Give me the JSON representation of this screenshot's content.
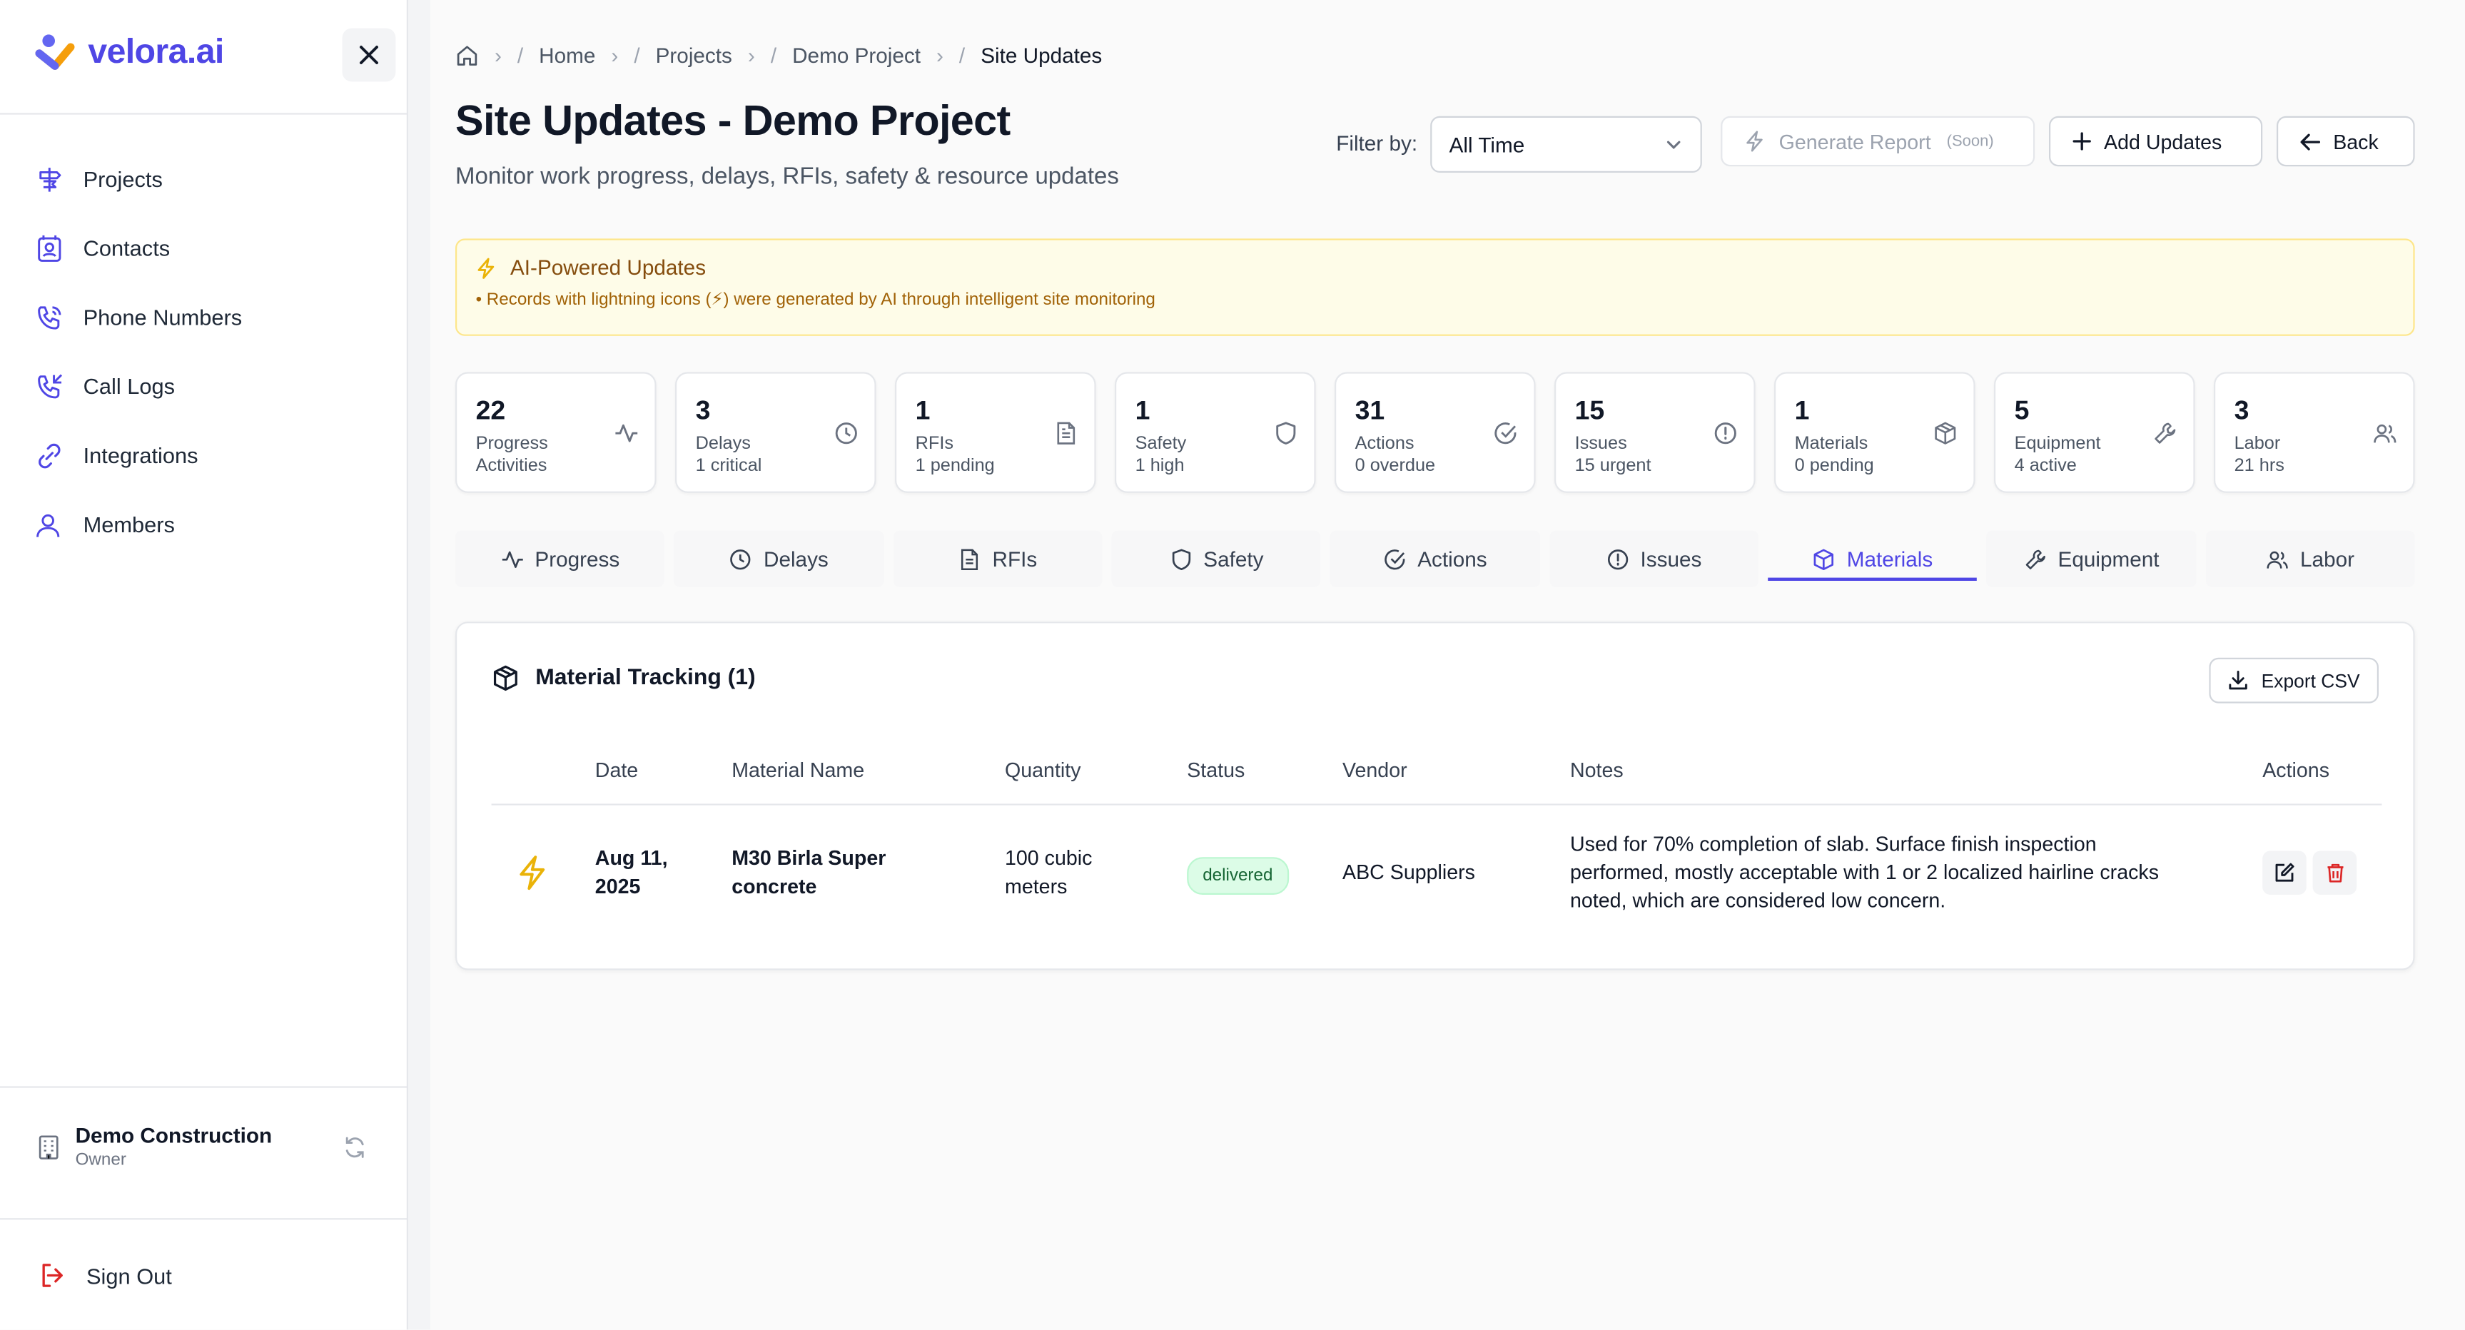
{
  "sidebar": {
    "brand": "velora.ai",
    "items": [
      {
        "label": "Projects",
        "icon": "signpost-icon"
      },
      {
        "label": "Contacts",
        "icon": "contact-icon"
      },
      {
        "label": "Phone Numbers",
        "icon": "phone-icon"
      },
      {
        "label": "Call Logs",
        "icon": "phone-log-icon"
      },
      {
        "label": "Integrations",
        "icon": "link-icon"
      },
      {
        "label": "Members",
        "icon": "users-icon"
      }
    ],
    "org": {
      "name": "Demo Construction",
      "role": "Owner"
    },
    "signout": "Sign Out"
  },
  "breadcrumb": [
    "Home",
    "Projects",
    "Demo Project",
    "Site Updates"
  ],
  "header": {
    "title": "Site Updates - Demo Project",
    "subtitle": "Monitor work progress, delays, RFIs, safety & resource updates",
    "filter_label": "Filter by:",
    "filter_value": "All Time",
    "generate_report": "Generate Report",
    "soon": "(Soon)",
    "add_updates": "Add Updates",
    "back": "Back"
  },
  "ai_banner": {
    "title": "AI-Powered Updates",
    "note": "• Records with lightning icons (⚡) were generated by AI through intelligent site monitoring"
  },
  "stats": [
    {
      "num": "22",
      "label": "Progress",
      "sub": "Activities",
      "icon": "activity-icon"
    },
    {
      "num": "3",
      "label": "Delays",
      "sub": "1 critical",
      "icon": "clock-icon"
    },
    {
      "num": "1",
      "label": "RFIs",
      "sub": "1 pending",
      "icon": "document-icon"
    },
    {
      "num": "1",
      "label": "Safety",
      "sub": "1 high",
      "icon": "shield-icon"
    },
    {
      "num": "31",
      "label": "Actions",
      "sub": "0 overdue",
      "icon": "check-circle-icon"
    },
    {
      "num": "15",
      "label": "Issues",
      "sub": "15 urgent",
      "icon": "alert-circle-icon"
    },
    {
      "num": "1",
      "label": "Materials",
      "sub": "0 pending",
      "icon": "package-icon"
    },
    {
      "num": "5",
      "label": "Equipment",
      "sub": "4 active",
      "icon": "wrench-icon"
    },
    {
      "num": "3",
      "label": "Labor",
      "sub": "21 hrs",
      "icon": "users-icon"
    }
  ],
  "tabs": [
    "Progress",
    "Delays",
    "RFIs",
    "Safety",
    "Actions",
    "Issues",
    "Materials",
    "Equipment",
    "Labor"
  ],
  "active_tab": "Materials",
  "panel": {
    "title": "Material Tracking (1)",
    "export": "Export CSV",
    "columns": [
      "Date",
      "Material Name",
      "Quantity",
      "Status",
      "Vendor",
      "Notes",
      "Actions"
    ],
    "rows": [
      {
        "date_line1": "Aug 11,",
        "date_line2": "2025",
        "material_line1": "M30 Birla Super",
        "material_line2": "concrete",
        "qty_line1": "100 cubic",
        "qty_line2": "meters",
        "status": "delivered",
        "vendor": "ABC Suppliers",
        "notes_line1": "Used for 70% completion of slab. Surface finish inspection",
        "notes_line2": "performed, mostly acceptable with 1 or 2 localized hairline cracks",
        "notes_line3": "noted, which are considered low concern."
      }
    ]
  },
  "colors": {
    "accent": "#4f46e5",
    "ai": "#eab308",
    "danger": "#dc2626",
    "success": "#166534"
  }
}
